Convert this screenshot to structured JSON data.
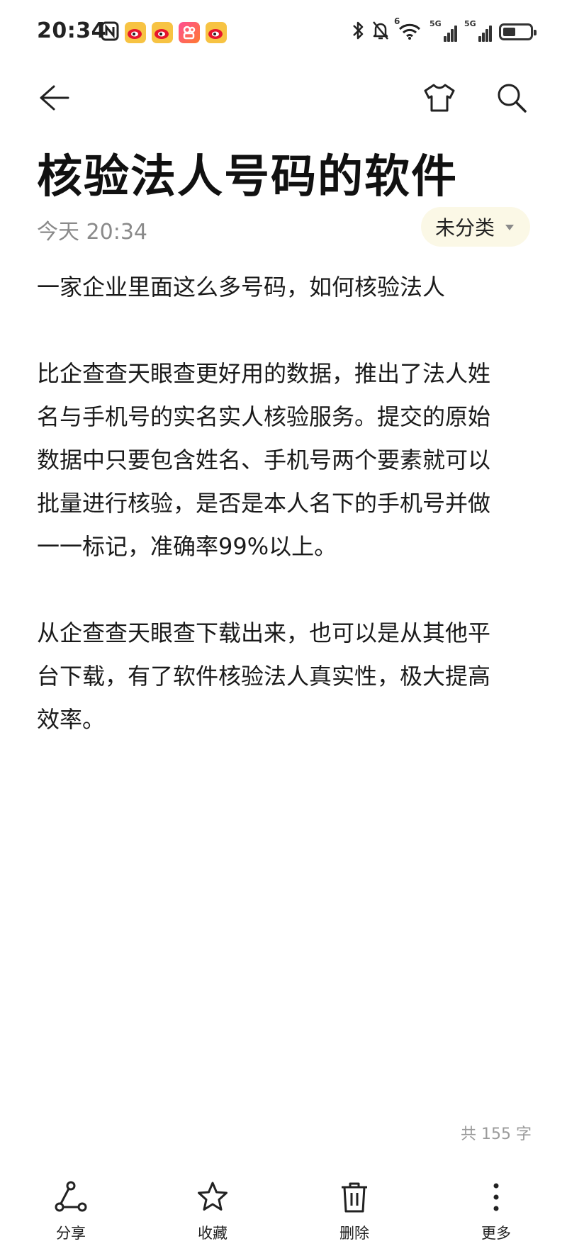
{
  "status_bar": {
    "time": "20:34",
    "network_tags": [
      "5G",
      "5G"
    ],
    "wifi_tag": "6"
  },
  "toolbar": {
    "back_icon": "arrow-left-icon",
    "skin_icon": "tshirt-icon",
    "search_icon": "search-icon"
  },
  "note": {
    "title": "核验法人号码的软件",
    "time": "今天 20:34",
    "category": "未分类",
    "paragraphs": [
      [
        "一家企业里面这么多号码，如何核验法人"
      ],
      [
        "比企查查天眼查更好用的数据，推出了法人姓",
        "名与手机号的实名实人核验服务。提交的原始",
        "数据中只要包含姓名、手机号两个要素就可以",
        "批量进行核验，是否是本人名下的手机号并做",
        "一一标记，准确率99%以上。"
      ],
      [
        "从企查查天眼查下载出来，也可以是从其他平",
        "台下载，有了软件核验法人真实性，极大提高",
        "效率。"
      ]
    ],
    "word_count": "共 155 字"
  },
  "bottom_bar": {
    "share_label": "分享",
    "favorite_label": "收藏",
    "delete_label": "删除",
    "more_label": "更多"
  },
  "colors": {
    "chip_background": "#fbf8e6",
    "meta_text": "#8a8a8a"
  }
}
